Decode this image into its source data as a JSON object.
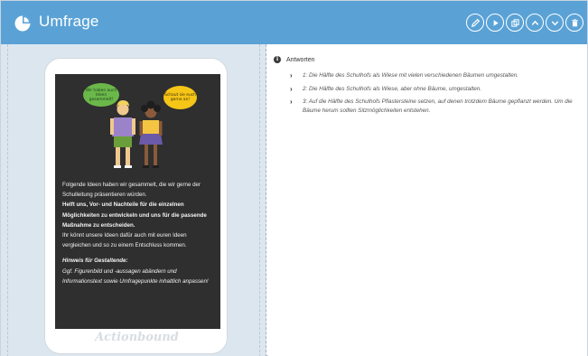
{
  "header": {
    "title": "Umfrage",
    "accent_color": "#5aa2d6",
    "logo_icon": "globe-pie-icon",
    "actions": [
      {
        "name": "edit-button",
        "icon": "pencil-icon"
      },
      {
        "name": "play-button",
        "icon": "play-icon"
      },
      {
        "name": "duplicate-button",
        "icon": "copy-icon"
      },
      {
        "name": "move-up-button",
        "icon": "chevron-up-icon"
      },
      {
        "name": "move-down-button",
        "icon": "chevron-down-icon"
      },
      {
        "name": "delete-button",
        "icon": "trash-icon"
      }
    ]
  },
  "preview": {
    "speech_left": "Wir haben auch Ideen gesammelt!",
    "speech_right": "Schaut sie euch gerne an!",
    "line1": "Folgende Ideen haben wir gesammelt, die wir gerne der Schulleitung präsentieren würden.",
    "line2": "Helft uns, Vor- und Nachteile für die einzelnen Möglichkeiten zu entwickeln und uns für die passende Maßnahme zu entscheiden.",
    "line3": "Ihr könnt unsere Ideen dafür auch mit euren Ideen vergleichen und so zu einem Entschluss kommen.",
    "hint_title": "Hinweis für Gestaltende:",
    "hint_text": "Ggf. Figurenbild und -aussagen abändern und Informationstext sowie Umfragepunkte inhaltlich anpassen!",
    "brand": "Actionbound"
  },
  "answers": {
    "title": "Antworten",
    "items": [
      "1: Die Hälfte des Schulhofs als Wiese mit vielen verschiedenen Bäumen umgestalten.",
      "2: Die Hälfte des Schulhofs als Wiese, aber ohne Bäume, umgestalten.",
      "3: Auf die Hälfte des Schulhofs Pflastersteine setzen, auf denen trotzdem Bäume gepflanzt werden. Um die Bäume herum sollten Sitzmöglichkeiten entstehen."
    ]
  }
}
